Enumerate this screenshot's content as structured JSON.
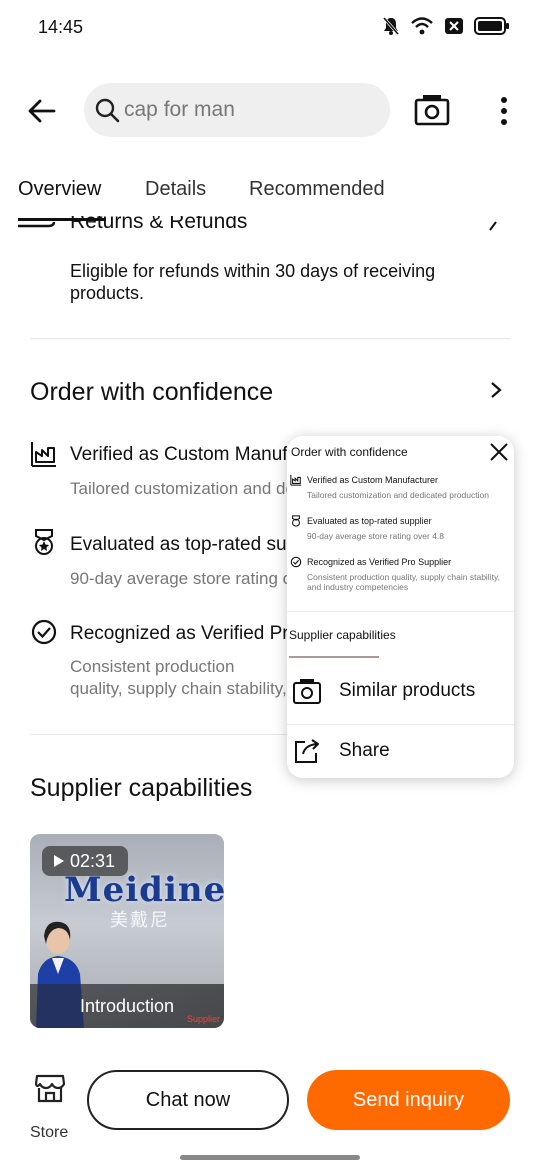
{
  "status": {
    "time": "14:45"
  },
  "search": {
    "query": "cap for man"
  },
  "tabs": [
    {
      "label": "Overview"
    },
    {
      "label": "Details"
    },
    {
      "label": "Recommended"
    }
  ],
  "returns": {
    "title": "Returns & Refunds",
    "description": "Eligible for refunds within 30 days of receiving products."
  },
  "confidence": {
    "title": "Order with confidence",
    "features": [
      {
        "title": "Verified as Custom Manufacturer",
        "description": "Tailored customization and dedicated production"
      },
      {
        "title": "Evaluated as top-rated supplier",
        "description": "90-day average store rating over 4.8"
      },
      {
        "title": "Recognized as Verified Pro Supplier",
        "description": "Consistent production quality, supply chain stability, and industry competencies"
      }
    ]
  },
  "supplier": {
    "title": "Supplier capabilities",
    "video": {
      "duration": "02:31",
      "caption": "Introduction",
      "logo_text": "Meidiney",
      "logo_cn": "美戴尼",
      "watermark": "Supplier"
    }
  },
  "popup": {
    "menu": [
      {
        "label": "Similar products"
      },
      {
        "label": "Share"
      }
    ]
  },
  "bottom": {
    "store_label": "Store",
    "chat_label": "Chat now",
    "inquiry_label": "Send inquiry"
  },
  "colors": {
    "accent": "#ff6a00"
  }
}
